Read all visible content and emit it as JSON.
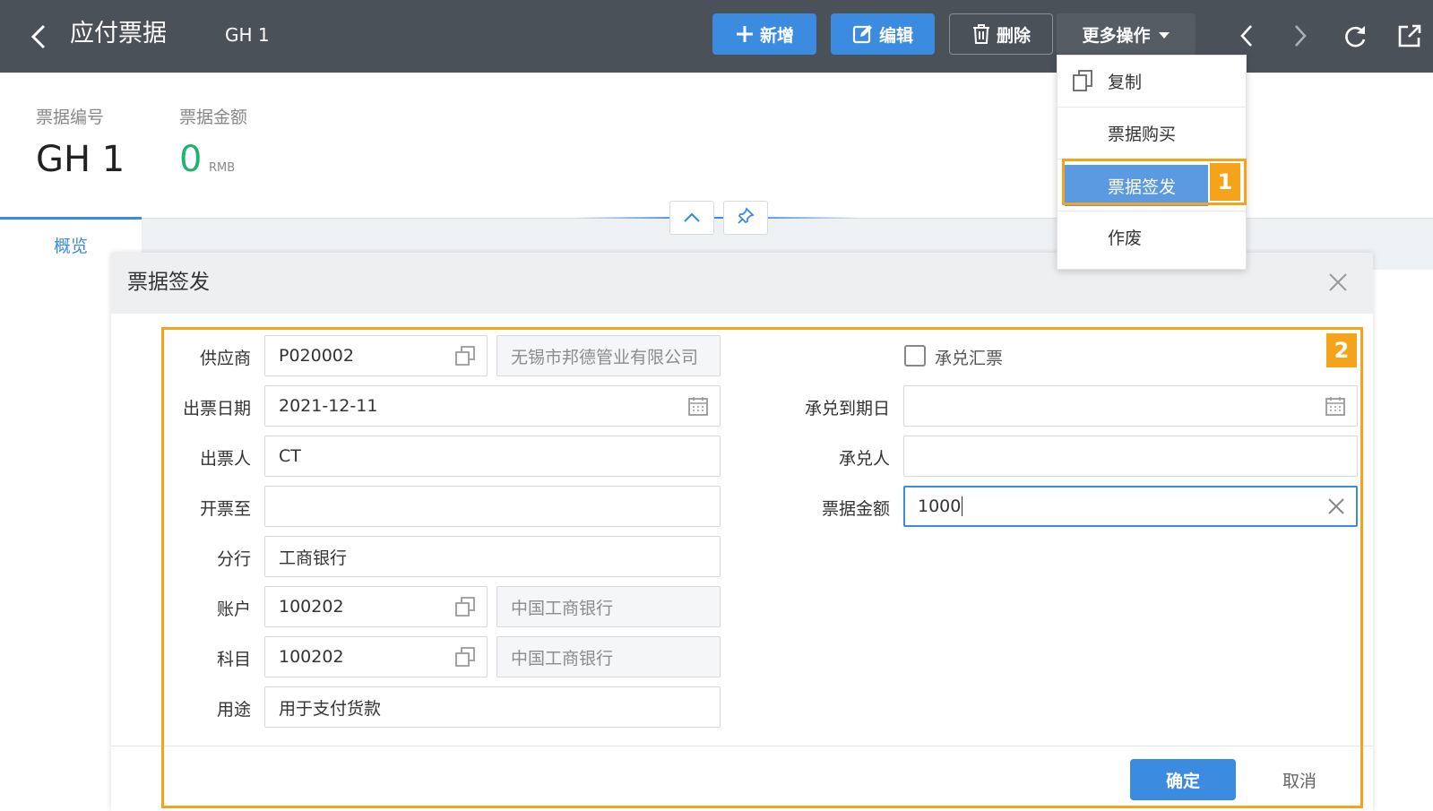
{
  "header": {
    "title": "应付票据",
    "doc_code": "GH 1",
    "buttons": {
      "add": "新增",
      "edit": "编辑",
      "delete": "删除",
      "more": "更多操作"
    }
  },
  "summary": {
    "code_label": "票据编号",
    "code_value": "GH 1",
    "amount_label": "票据金额",
    "amount_value": "0",
    "amount_unit": "RMB"
  },
  "tabs": [
    {
      "label": "概览",
      "active": true
    }
  ],
  "more_menu": {
    "items": [
      {
        "label": "复制",
        "icon": "copy-icon"
      },
      {
        "label": "票据购买"
      },
      {
        "label": "票据签发",
        "active": true
      },
      {
        "label": "作废"
      }
    ]
  },
  "badges": {
    "step1": "1",
    "step2": "2"
  },
  "modal": {
    "title": "票据签发",
    "fields": {
      "supplier": {
        "label": "供应商",
        "code": "P020002",
        "name": "无锡市邦德管业有限公司"
      },
      "issue_date": {
        "label": "出票日期",
        "value": "2021-12-11"
      },
      "drawer": {
        "label": "出票人",
        "value": "CT"
      },
      "issue_to": {
        "label": "开票至",
        "value": ""
      },
      "branch": {
        "label": "分行",
        "value": "工商银行"
      },
      "account": {
        "label": "账户",
        "code": "100202",
        "name": "中国工商银行"
      },
      "subject": {
        "label": "科目",
        "code": "100202",
        "name": "中国工商银行"
      },
      "purpose": {
        "label": "用途",
        "value": "用于支付货款"
      },
      "acceptance_bill": {
        "label": "承兑汇票",
        "checked": false
      },
      "acceptance_due": {
        "label": "承兑到期日",
        "value": ""
      },
      "acceptor": {
        "label": "承兑人",
        "value": ""
      },
      "amount": {
        "label": "票据金额",
        "value": "1000"
      }
    },
    "ok": "确定",
    "cancel": "取消"
  },
  "colors": {
    "topbar": "#4b5159",
    "primary": "#3b8be0",
    "highlight": "#f4a31a",
    "amount_green": "#1fb46e"
  }
}
